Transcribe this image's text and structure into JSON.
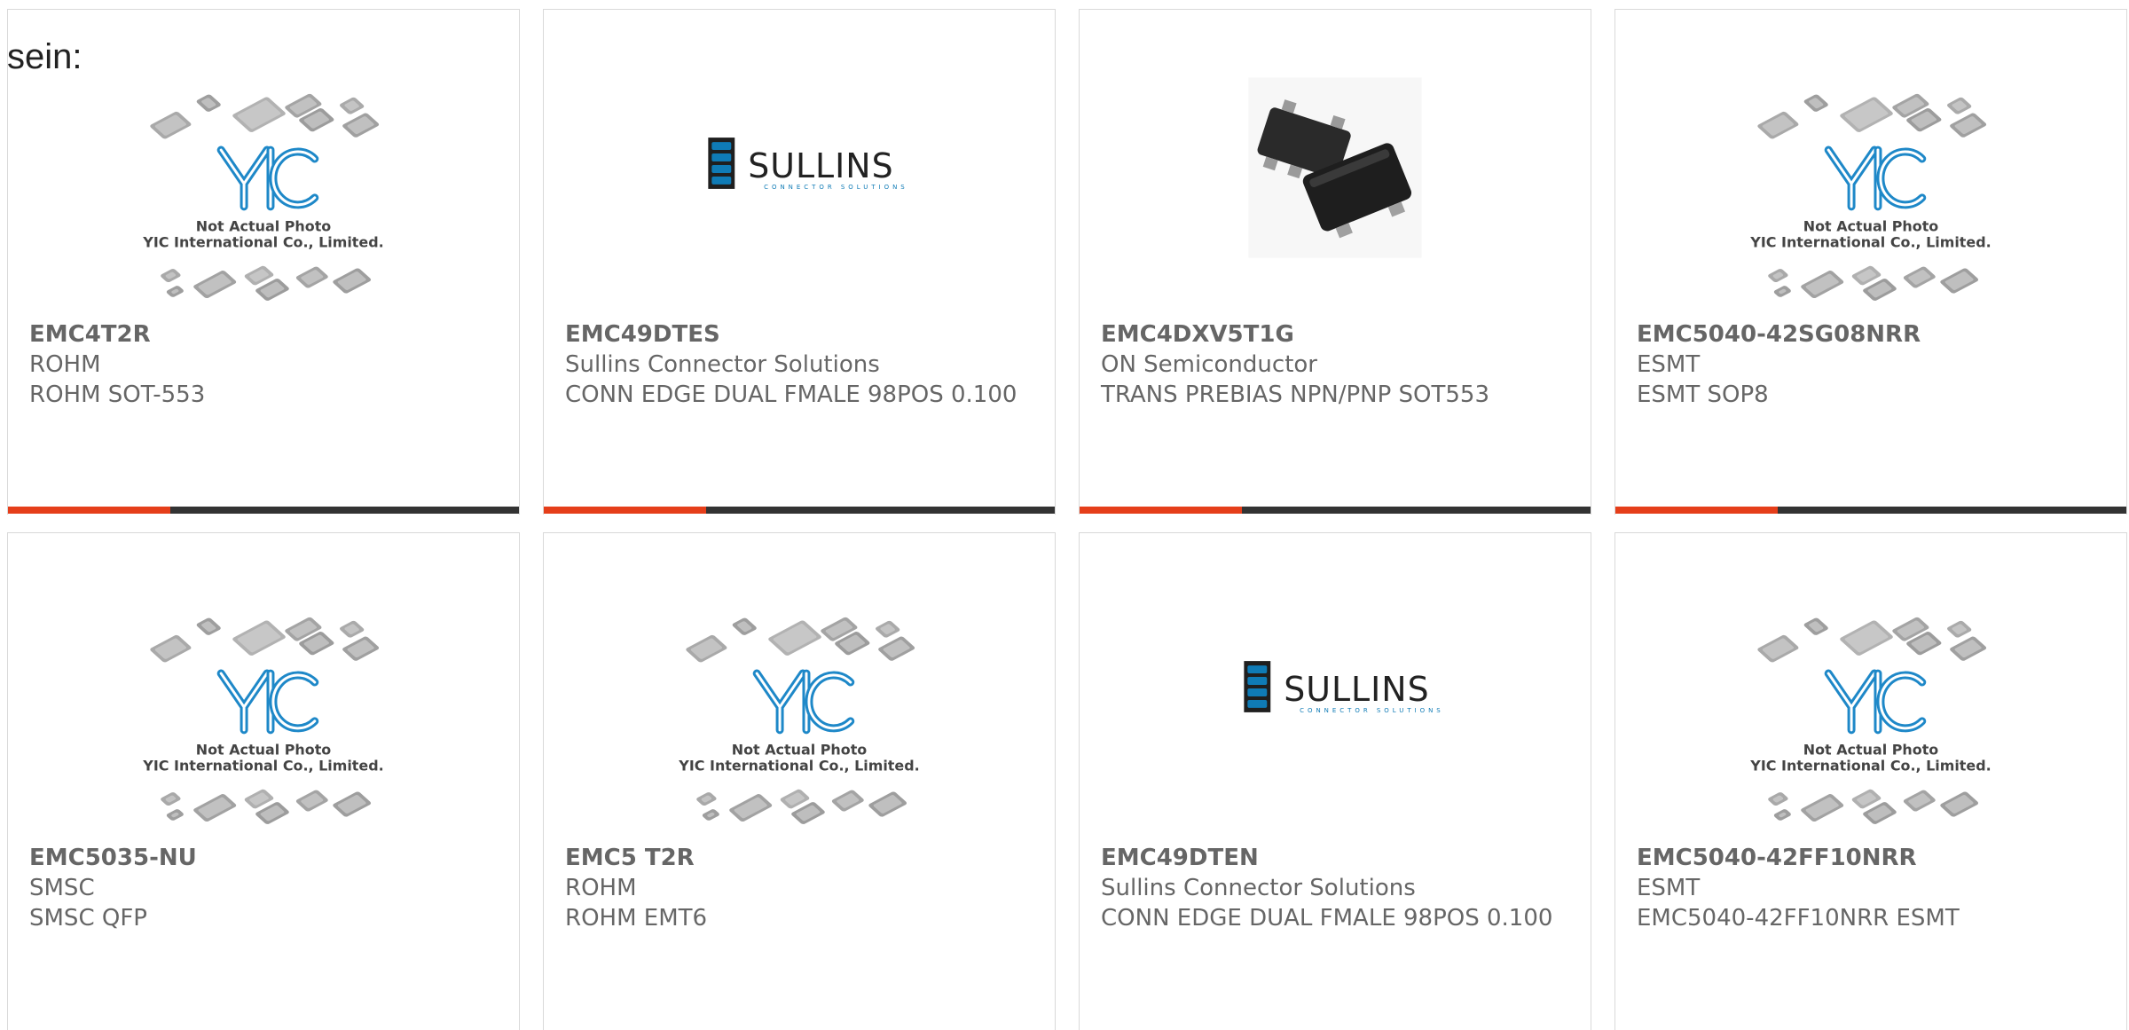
{
  "heading_fragment": "sein:",
  "colors": {
    "accent": "#e53e1a",
    "bar": "#333333",
    "text": "#666666",
    "border": "#d9d9d9",
    "yic_blue": "#1e88c8",
    "sullins_blue": "#0f7bb6"
  },
  "products": [
    {
      "pn": "EMC4T2R",
      "mfr": "ROHM",
      "desc": "ROHM SOT-553",
      "image": "yic-placeholder",
      "img_line1": "Not Actual Photo",
      "img_line2": "YIC International Co., Limited."
    },
    {
      "pn": "EMC49DTES",
      "mfr": "Sullins Connector Solutions",
      "desc": "CONN EDGE DUAL FMALE 98POS 0.100",
      "image": "sullins-logo",
      "logo_text": "SULLINS",
      "logo_sub": "CONNECTOR SOLUTIONS"
    },
    {
      "pn": "EMC4DXV5T1G",
      "mfr": "ON Semiconductor",
      "desc": "TRANS PREBIAS NPN/PNP SOT553",
      "image": "sot553-photo"
    },
    {
      "pn": "EMC5040-42SG08NRR",
      "mfr": "ESMT",
      "desc": "ESMT SOP8",
      "image": "yic-placeholder",
      "img_line1": "Not Actual Photo",
      "img_line2": "YIC International Co., Limited."
    },
    {
      "pn": "EMC5035-NU",
      "mfr": "SMSC",
      "desc": "SMSC QFP",
      "image": "yic-placeholder",
      "img_line1": "Not Actual Photo",
      "img_line2": "YIC International Co., Limited."
    },
    {
      "pn": "EMC5 T2R",
      "mfr": "ROHM",
      "desc": "ROHM EMT6",
      "image": "yic-placeholder",
      "img_line1": "Not Actual Photo",
      "img_line2": "YIC International Co., Limited."
    },
    {
      "pn": "EMC49DTEN",
      "mfr": "Sullins Connector Solutions",
      "desc": "CONN EDGE DUAL FMALE 98POS 0.100",
      "image": "sullins-logo",
      "logo_text": "SULLINS",
      "logo_sub": "CONNECTOR SOLUTIONS"
    },
    {
      "pn": "EMC5040-42FF10NRR",
      "mfr": "ESMT",
      "desc": "EMC5040-42FF10NRR ESMT",
      "image": "yic-placeholder",
      "img_line1": "Not Actual Photo",
      "img_line2": "YIC International Co., Limited."
    }
  ]
}
